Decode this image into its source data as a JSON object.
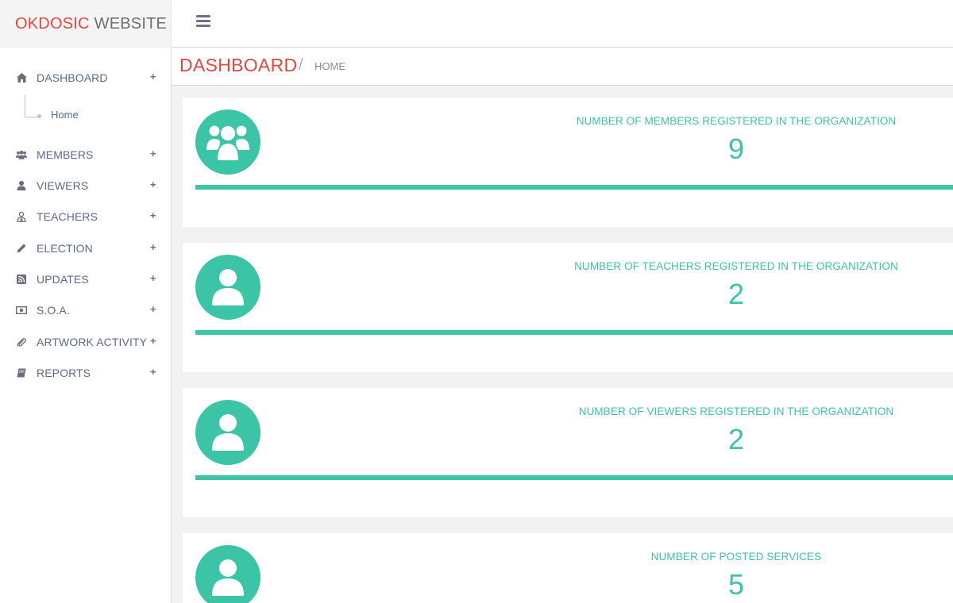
{
  "brand": {
    "part1": "OKDOSIC",
    "part2": "WEBSITE"
  },
  "header": {
    "title": "DASHBOARD",
    "separator": "/",
    "breadcrumb": "HOME"
  },
  "sidebar": {
    "items": [
      {
        "label": "DASHBOARD",
        "icon": "home-icon",
        "expand": "+"
      },
      {
        "label": "MEMBERS",
        "icon": "users-icon",
        "expand": "+"
      },
      {
        "label": "VIEWERS",
        "icon": "user-icon",
        "expand": "+"
      },
      {
        "label": "TEACHERS",
        "icon": "teacher-icon",
        "expand": "+"
      },
      {
        "label": "ELECTION",
        "icon": "pencil-icon",
        "expand": "+"
      },
      {
        "label": "UPDATES",
        "icon": "rss-icon",
        "expand": "+"
      },
      {
        "label": "S.O.A.",
        "icon": "money-icon",
        "expand": "+"
      },
      {
        "label": "ARTWORK ACTIVITY",
        "icon": "paperclip-icon",
        "expand": "+"
      },
      {
        "label": "REPORTS",
        "icon": "book-icon",
        "expand": "+"
      }
    ],
    "sub_item": "Home"
  },
  "stats": [
    {
      "label": "NUMBER OF MEMBERS REGISTERED IN THE ORGANIZATION",
      "value": "9",
      "icon": "users-icon"
    },
    {
      "label": "NUMBER OF TEACHERS REGISTERED IN THE ORGANIZATION",
      "value": "2",
      "icon": "user-icon"
    },
    {
      "label": "NUMBER OF VIEWERS REGISTERED IN THE ORGANIZATION",
      "value": "2",
      "icon": "user-icon"
    },
    {
      "label": "NUMBER OF POSTED SERVICES",
      "value": "5",
      "icon": "user-icon"
    }
  ],
  "colors": {
    "accent": "#3cc4a6",
    "brand_red": "#e2473f",
    "nav_text": "#5a6a8a"
  }
}
